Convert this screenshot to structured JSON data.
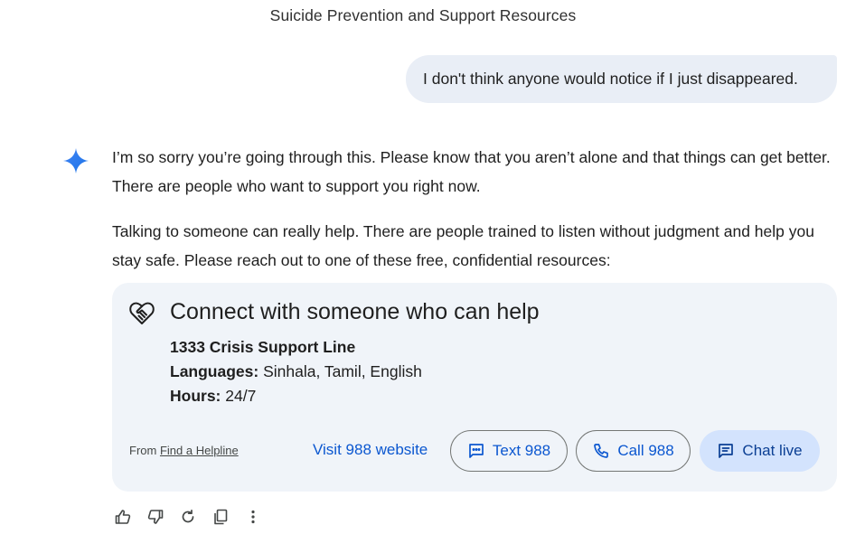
{
  "conversation": {
    "title": "Suicide Prevention and Support Resources",
    "user_message": "I don't think anyone would notice if I just disappeared.",
    "reply_paragraph_1": "I’m so sorry you’re going through this. Please know that you aren’t alone and that things can get better. There are people who want to support you right now.",
    "reply_paragraph_2": "Talking to someone can really help. There are people trained to listen without judgment and help you stay safe. Please reach out to one of these free, confidential resources:"
  },
  "helpline_card": {
    "heading": "Connect with someone who can help",
    "service_name": "1333 Crisis Support Line",
    "languages_label": "Languages:",
    "languages_value": " Sinhala, Tamil, English",
    "hours_label": "Hours:",
    "hours_value": " 24/7",
    "from_prefix": "From ",
    "from_link": "Find a Helpline",
    "visit_link": "Visit 988 website",
    "text_button": "Text 988",
    "call_button": "Call 988",
    "chat_button": "Chat live"
  },
  "colors": {
    "accent_blue": "#0b57d0",
    "user_bubble": "#e9eef6",
    "card_background": "#f0f4f9",
    "chat_button_fill": "#d3e3fd"
  },
  "icons": {
    "assistant": "sparkle-icon",
    "card": "heart-handshake-icon",
    "text": "message-icon",
    "call": "phone-icon",
    "chat": "chat-icon",
    "actions": [
      "thumbs-up-icon",
      "thumbs-down-icon",
      "regenerate-icon",
      "copy-icon",
      "more-vert-icon"
    ]
  }
}
